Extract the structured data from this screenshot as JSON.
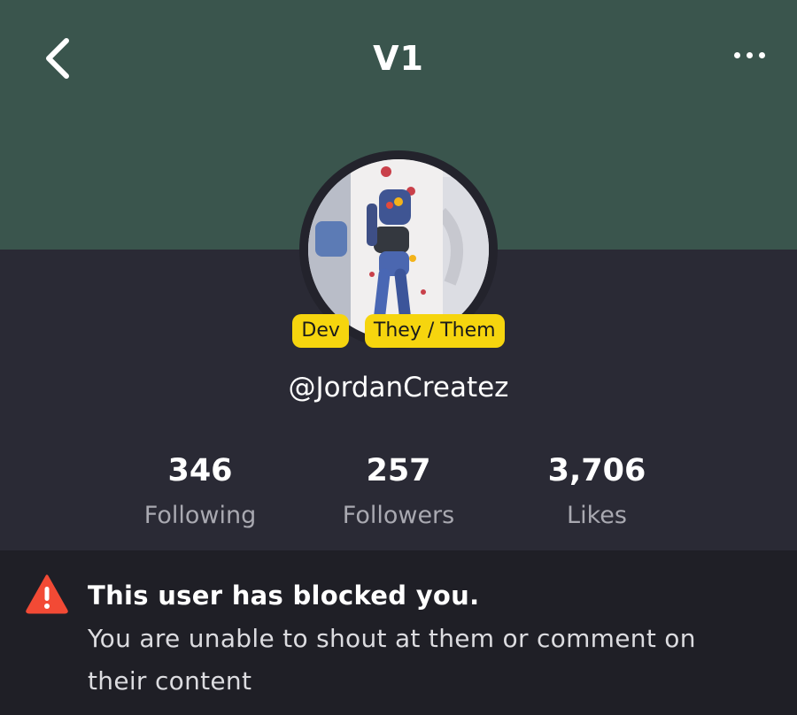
{
  "header": {
    "title": "V1",
    "back_icon": "chevron-left-icon",
    "more_icon": "more-horizontal-icon",
    "background_color": "#3a554d"
  },
  "profile": {
    "badges": [
      "Dev",
      "They / Them"
    ],
    "badge_color": "#f6d50e",
    "handle": "@JordanCreatez"
  },
  "stats": [
    {
      "value": "346",
      "label": "Following"
    },
    {
      "value": "257",
      "label": "Followers"
    },
    {
      "value": "3,706",
      "label": "Likes"
    }
  ],
  "notice": {
    "icon": "warning-icon",
    "icon_color": "#f24a35",
    "title": "This user has blocked you.",
    "body": "You are unable to shout at them or comment on their content"
  }
}
